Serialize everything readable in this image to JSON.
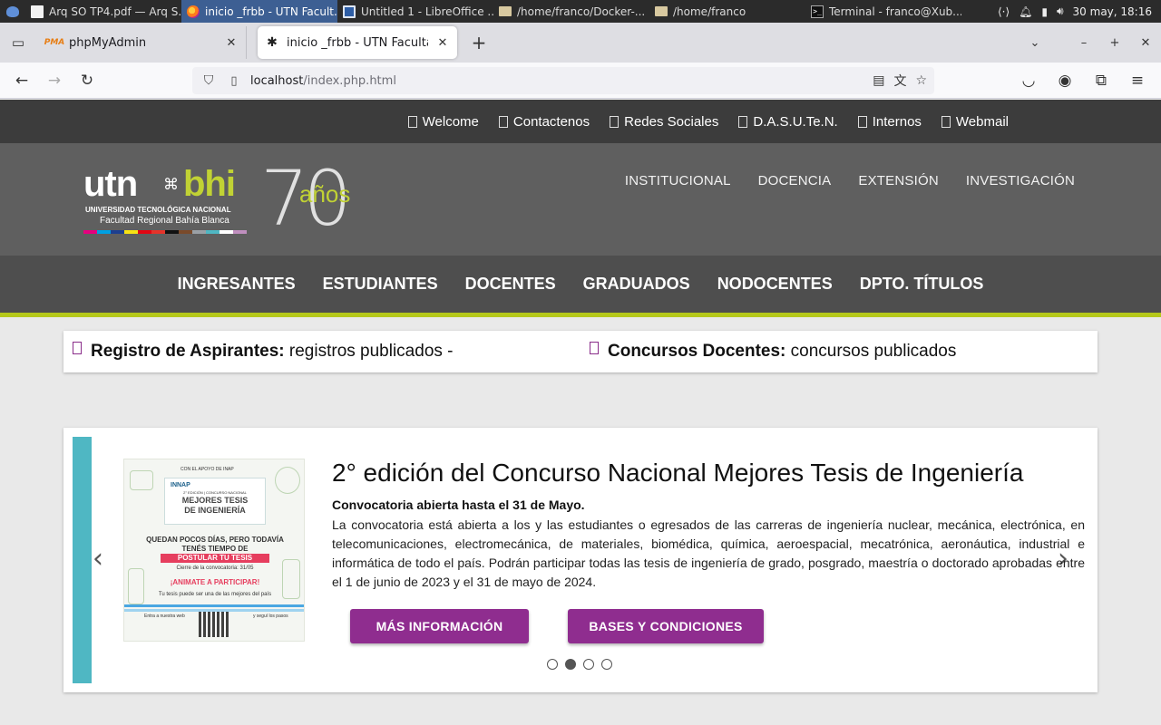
{
  "os_panel": {
    "tasks": [
      {
        "label": "Arq SO TP4.pdf — Arq S...",
        "icon": "document-icon",
        "active": false
      },
      {
        "label": "inicio _frbb - UTN Facult...",
        "icon": "firefox-icon",
        "active": true
      },
      {
        "label": "Untitled 1 - LibreOffice ...",
        "icon": "libreoffice-icon",
        "active": false
      },
      {
        "label": "/home/franco/Docker-...",
        "icon": "folder-icon",
        "active": false
      },
      {
        "label": "/home/franco",
        "icon": "folder-icon",
        "active": false
      },
      {
        "label": "Terminal - franco@Xub...",
        "icon": "terminal-icon",
        "active": false
      }
    ],
    "clock": "30 may, 18:16"
  },
  "browser": {
    "tabs": [
      {
        "label": "phpMyAdmin",
        "favicon": "PMA",
        "active": false
      },
      {
        "label": "inicio _frbb - UTN Facultad Regional Bahía Blanca",
        "favicon": "utn-favicon",
        "active": true
      }
    ],
    "url_host": "localhost",
    "url_path": "/index.php.html"
  },
  "site": {
    "top_links": [
      "Welcome",
      "Contactenos",
      "Redes Sociales",
      "D.A.S.U.Te.N.",
      "Internos",
      "Webmail"
    ],
    "logo": {
      "utn": "utn",
      "bhi": "bhi",
      "university": "UNIVERSIDAD TECNOLÓGICA NACIONAL",
      "faculty": "Facultad Regional Bahía Blanca",
      "anniversary_number": "70",
      "anniversary_word": "años",
      "color_bar": [
        "#e6007e",
        "#00a0e3",
        "#1d3f8f",
        "#f7e214",
        "#e30613",
        "#e5332a",
        "#111111",
        "#7a4a2a",
        "#9aa0a6",
        "#4fb7c3",
        "#ffffff",
        "#c08fbf"
      ]
    },
    "main_menu": [
      "INSTITUCIONAL",
      "DOCENCIA",
      "EXTENSIÓN",
      "INVESTIGACIÓN"
    ],
    "secondary_menu": [
      "INGRESANTES",
      "ESTUDIANTES",
      "DOCENTES",
      "GRADUADOS",
      "NODOCENTES",
      "DPTO. TÍTULOS"
    ],
    "news": [
      {
        "bold": "Registro de Aspirantes:",
        "text": "registros publicados -"
      },
      {
        "bold": "Concursos Docentes:",
        "text": "concursos publicados"
      }
    ],
    "slide": {
      "title": "2° edición del Concurso Nacional Mejores Tesis de Ingeniería",
      "subtitle": "Convocatoria abierta hasta el 31 de Mayo.",
      "body": "La convocatoria está abierta a los y las estudiantes o egresados de las carreras de ingeniería nuclear, mecánica, electrónica, en telecomunicaciones, electromecánica, de materiales, biomédica, química, aeroespacial, mecatrónica, aeronáutica, industrial e informática de todo el país. Podrán participar todas las tesis de ingeniería de grado, posgrado, maestría o doctorado aprobadas entre el 1 de junio de 2023 y el 31 de mayo de 2024.",
      "button_more": "MÁS INFORMACIÓN",
      "button_bases": "BASES Y CONDICIONES",
      "active_index": 1,
      "count": 4,
      "poster": {
        "institution": "CON EL APOYO DE INAP",
        "org": "INNAP",
        "edition": "2° EDICIÓN | CONCURSO NACIONAL",
        "title_line1": "MEJORES TESIS",
        "title_line2": "DE INGENIERÍA",
        "quedan": "QUEDAN POCOS DÍAS, PERO TODAVÍA TENÉS TIEMPO DE",
        "postular": "POSTULAR TU TESIS",
        "cierre": "Cierre de la convocatoria: 31/05",
        "animate": "¡ANIMATE A PARTICIPAR!",
        "tesis": "Tu tesis puede ser una de las mejores del país",
        "entra": "Entra a nuestra web",
        "segui": "y seguí los pasos"
      }
    },
    "colors": {
      "accent_green": "#b5c81a",
      "button_purple": "#8f2d8f",
      "carousel_accent": "#4fb7c3"
    }
  }
}
